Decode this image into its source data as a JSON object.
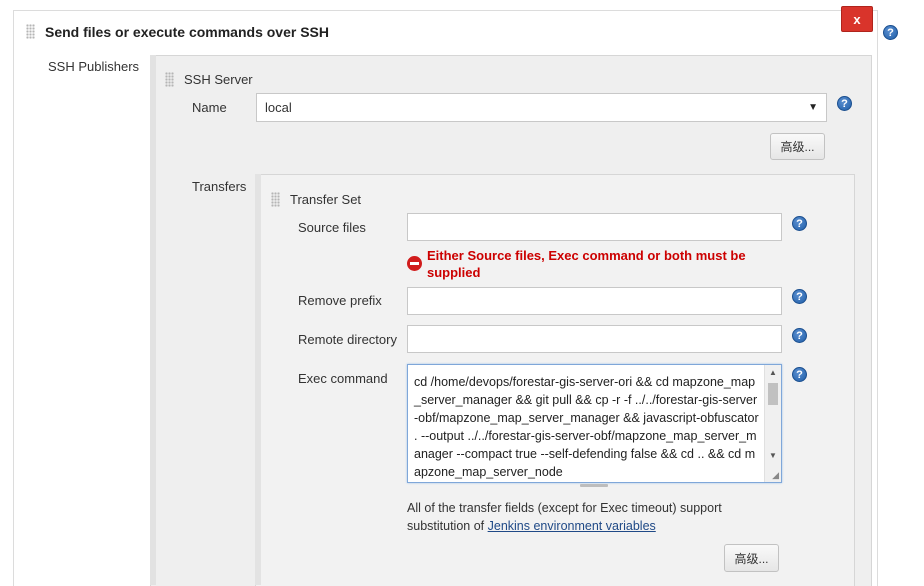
{
  "section": {
    "title": "Send files or execute commands over SSH",
    "close_label": "x"
  },
  "ssh_publishers": {
    "label": "SSH Publishers",
    "server": {
      "title": "SSH Server",
      "name_label": "Name",
      "name_value": "local",
      "advanced_label": "高级..."
    },
    "transfers": {
      "label": "Transfers",
      "set_title": "Transfer Set",
      "source_files_label": "Source files",
      "source_files_value": "",
      "error_message": "Either Source files, Exec command or both must be supplied",
      "remove_prefix_label": "Remove prefix",
      "remove_prefix_value": "",
      "remote_directory_label": "Remote directory",
      "remote_directory_value": "",
      "exec_command_label": "Exec command",
      "exec_command_value": "cd /home/devops/forestar-gis-server-ori && cd mapzone_map_server_manager && git pull && cp -r -f ../../forestar-gis-server-obf/mapzone_map_server_manager && javascript-obfuscator . --output ../../forestar-gis-server-obf/mapzone_map_server_manager --compact true --self-defending false && cd .. && cd mapzone_map_server_node",
      "note_text": "All of the transfer fields (except for Exec timeout) support substitution of",
      "note_link": "Jenkins environment variables",
      "advanced_label": "高级..."
    }
  },
  "help_label": "?",
  "colors": {
    "close_red": "#d9342b",
    "error_red": "#cc0000",
    "help_blue": "#1f5ea8",
    "link_blue": "#204a87"
  }
}
